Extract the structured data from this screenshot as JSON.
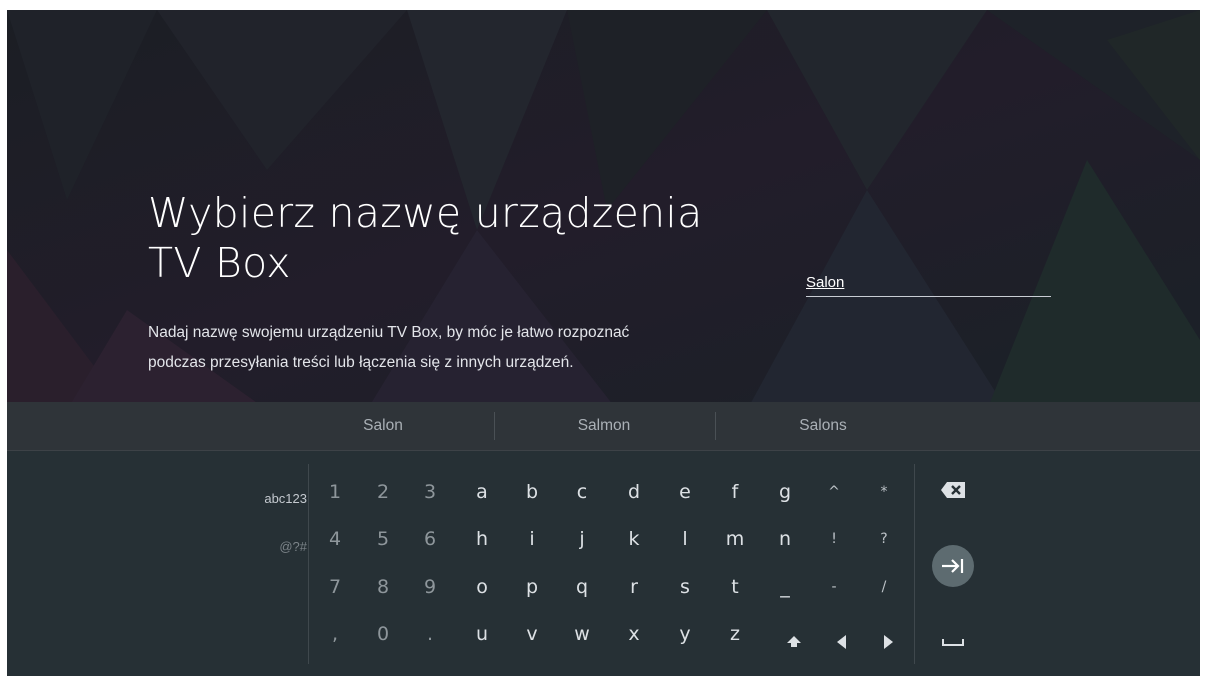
{
  "setup": {
    "title_line1": "Wybierz nazwę urządzenia",
    "title_line2": "TV Box",
    "description_line1": "Nadaj nazwę swojemu urządzeniu TV Box, by móc je łatwo rozpoznać",
    "description_line2": "podczas przesyłania treści lub łączenia się z innych urządzeń.",
    "name_value": "Salon"
  },
  "suggestions": [
    "Salon",
    "Salmon",
    "Salons"
  ],
  "keyboard": {
    "modes": [
      "abc123",
      "@?#"
    ],
    "rows": [
      [
        "1",
        "2",
        "3",
        "a",
        "b",
        "c",
        "d",
        "e",
        "f",
        "g",
        "^",
        "*"
      ],
      [
        "4",
        "5",
        "6",
        "h",
        "i",
        "j",
        "k",
        "l",
        "m",
        "n",
        "!",
        "?"
      ],
      [
        "7",
        "8",
        "9",
        "o",
        "p",
        "q",
        "r",
        "s",
        "t",
        "_",
        "-",
        "/"
      ],
      [
        ",",
        "0",
        ".",
        "u",
        "v",
        "w",
        "x",
        "y",
        "z"
      ]
    ],
    "function_keys": [
      "shift-icon",
      "arrow-left-icon",
      "arrow-right-icon",
      "backspace-icon",
      "enter-next-icon",
      "space-icon"
    ]
  }
}
